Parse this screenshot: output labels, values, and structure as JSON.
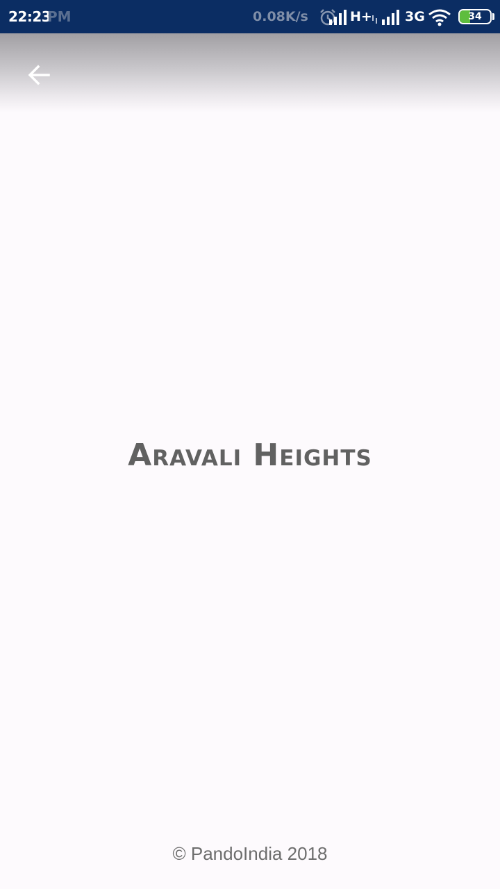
{
  "status_bar": {
    "time": "22:23",
    "ghost_time_suffix": "PM",
    "net_speed": "0.08K/s",
    "network_1": "H+",
    "network_2": "3G",
    "battery_level": 34,
    "battery_text": "34",
    "background_color": "#0b2d63",
    "battery_color": "#5ebd3e",
    "icons": [
      "alarm-icon",
      "signal-icon",
      "signal-icon",
      "wifi-icon",
      "battery-icon"
    ]
  },
  "app_bar": {
    "back_icon": "arrow-back-icon"
  },
  "main": {
    "title": "Aravali Heights"
  },
  "footer": {
    "copyright": "© PandoIndia 2018"
  }
}
